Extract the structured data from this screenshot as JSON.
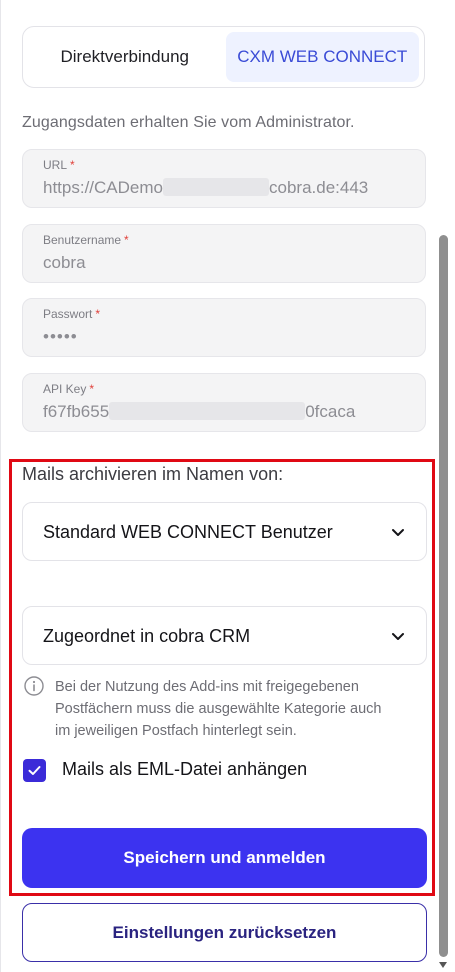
{
  "tabs": [
    {
      "label": "Direktverbindung",
      "active": false
    },
    {
      "label": "CXM WEB CONNECT",
      "active": true
    }
  ],
  "hint": "Zugangsdaten erhalten Sie vom Administrator.",
  "fields": {
    "url": {
      "label": "URL",
      "required": "*",
      "value_start": "https://CADemo",
      "value_end": "cobra.de:443"
    },
    "username": {
      "label": "Benutzername",
      "required": "*",
      "value": "cobra"
    },
    "password": {
      "label": "Passwort",
      "required": "*",
      "value": "•••••"
    },
    "api_key": {
      "label": "API Key",
      "required": "*",
      "value_start": "f67fb655",
      "value_end": "0fcaca"
    }
  },
  "archive": {
    "title": "Mails archivieren im Namen von:",
    "select1": "Standard WEB CONNECT Benutzer",
    "select2": "Zugeordnet in cobra CRM",
    "info": "Bei der Nutzung des Add-ins mit freigegebenen Postfächern muss die ausgewählte Kategorie auch im jeweiligen Postfach hinterlegt sein.",
    "checkbox_label": "Mails als EML-Datei anhängen",
    "checkbox_checked": true
  },
  "buttons": {
    "save": "Speichern und anmelden",
    "reset": "Einstellungen zurücksetzen"
  },
  "colors": {
    "accent": "#3c33f0",
    "highlight": "#e00914",
    "required": "#e0403a",
    "tab_active_bg": "#eef2ff"
  },
  "icons": [
    "chevron-down-icon",
    "info-icon",
    "check-icon"
  ]
}
